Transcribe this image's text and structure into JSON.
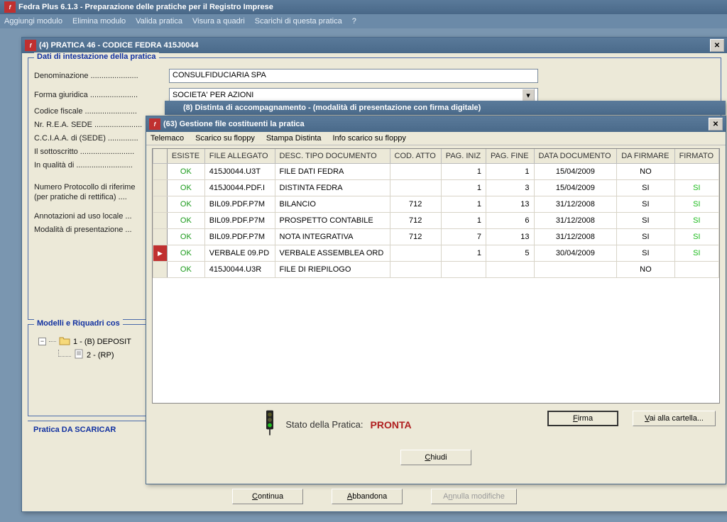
{
  "app": {
    "title": "Fedra Plus 6.1.3 - Preparazione delle pratiche per il Registro Imprese",
    "menu": [
      "Aggiungi modulo",
      "Elimina modulo",
      "Valida pratica",
      "Visura a quadri",
      "Scarichi di questa pratica",
      "?"
    ]
  },
  "win4": {
    "title": "(4) PRATICA 46 - CODICE FEDRA 415J0044",
    "group_header": "Dati di intestazione della pratica",
    "labels": {
      "denominazione": "Denominazione ......................",
      "forma": "Forma giuridica ......................",
      "codfisc": "Codice fiscale ........................",
      "rea": "Nr. R.E.A. SEDE ......................",
      "cciaa": "C.C.I.A.A. di (SEDE) ..............",
      "sottoscritto": "Il sottoscritto .........................",
      "qualita": "In qualità di ..........................",
      "protocollo1": "Numero Protocollo di riferime",
      "protocollo2": "(per pratiche di rettifica) ....",
      "annotazioni": "Annotazioni ad  uso locale ...",
      "modalita": "Modalità di presentazione ..."
    },
    "fields": {
      "denominazione": "CONSULFIDUCIARIA SPA",
      "forma": "SOCIETA' PER AZIONI"
    },
    "group_models": "Modelli e Riquadri cos",
    "tree": {
      "root": "1 - (B) DEPOSIT",
      "child": "2 - (RP)"
    },
    "status_text": "Pratica DA SCARICAR",
    "buttons": {
      "continua": "Continua",
      "abbandona": "Abbandona",
      "annulla": "Annulla modifiche"
    }
  },
  "win8": {
    "title": "(8) Distinta di accompagnamento - (modalità di presentazione con firma digitale)"
  },
  "win63": {
    "title": "(63) Gestione file costituenti la pratica",
    "menu": [
      "Telemaco",
      "Scarico su floppy",
      "Stampa Distinta",
      "Info scarico su floppy"
    ],
    "columns": [
      "ESISTE",
      "FILE ALLEGATO",
      "DESC. TIPO DOCUMENTO",
      "COD. ATTO",
      "PAG. INIZ",
      "PAG. FINE",
      "DATA DOCUMENTO",
      "DA FIRMARE",
      "FIRMATO"
    ],
    "rows": [
      {
        "sel": false,
        "esiste": "OK",
        "file": "415J0044.U3T",
        "desc": "FILE DATI FEDRA",
        "cod": "",
        "pini": "1",
        "pfin": "1",
        "data": "15/04/2009",
        "dafirm": "NO",
        "firm": ""
      },
      {
        "sel": false,
        "esiste": "OK",
        "file": "415J0044.PDF.I",
        "desc": "DISTINTA FEDRA",
        "cod": "",
        "pini": "1",
        "pfin": "3",
        "data": "15/04/2009",
        "dafirm": "SI",
        "firm": "SI"
      },
      {
        "sel": false,
        "esiste": "OK",
        "file": "BIL09.PDF.P7M",
        "desc": "BILANCIO",
        "cod": "712",
        "pini": "1",
        "pfin": "13",
        "data": "31/12/2008",
        "dafirm": "SI",
        "firm": "SI"
      },
      {
        "sel": false,
        "esiste": "OK",
        "file": "BIL09.PDF.P7M",
        "desc": "PROSPETTO CONTABILE",
        "cod": "712",
        "pini": "1",
        "pfin": "6",
        "data": "31/12/2008",
        "dafirm": "SI",
        "firm": "SI"
      },
      {
        "sel": false,
        "esiste": "OK",
        "file": "BIL09.PDF.P7M",
        "desc": "NOTA INTEGRATIVA",
        "cod": "712",
        "pini": "7",
        "pfin": "13",
        "data": "31/12/2008",
        "dafirm": "SI",
        "firm": "SI"
      },
      {
        "sel": true,
        "esiste": "OK",
        "file": "VERBALE 09.PD",
        "desc": "VERBALE ASSEMBLEA ORD",
        "cod": "",
        "pini": "1",
        "pfin": "5",
        "data": "30/04/2009",
        "dafirm": "SI",
        "firm": "SI"
      },
      {
        "sel": false,
        "esiste": "OK",
        "file": "415J0044.U3R",
        "desc": "FILE DI RIEPILOGO",
        "cod": "",
        "pini": "",
        "pfin": "",
        "data": "",
        "dafirm": "NO",
        "firm": ""
      }
    ],
    "buttons": {
      "firma": "Firma",
      "vai": "Vai alla cartella...",
      "chiudi": "Chiudi"
    },
    "status": {
      "label": "Stato della Pratica:",
      "value": "PRONTA"
    }
  }
}
